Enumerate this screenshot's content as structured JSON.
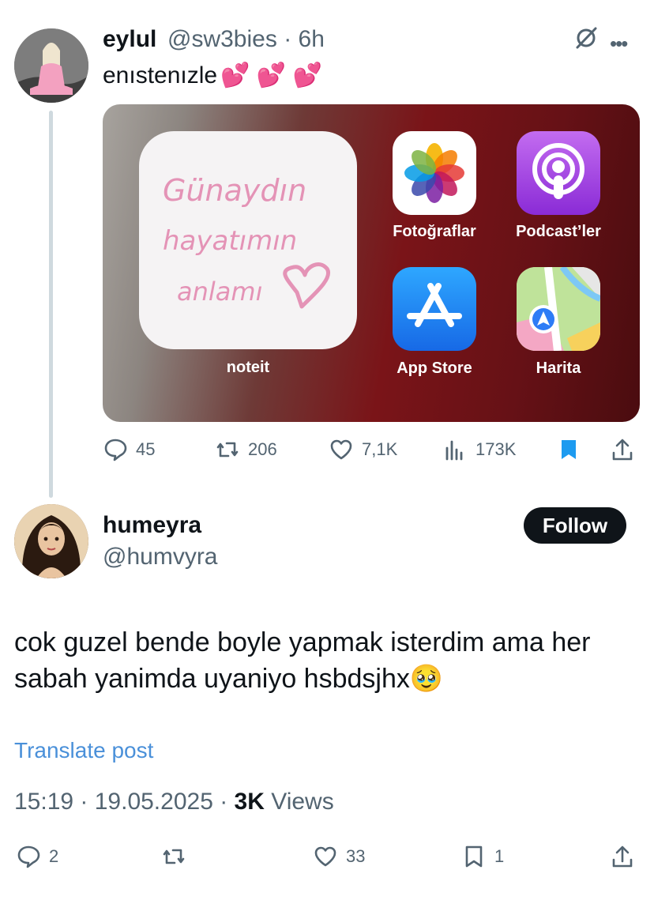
{
  "parent_tweet": {
    "author_name": "eylul",
    "author_handle": "@sw3bies",
    "time_ago": "· 6h",
    "text": "enıstenızle",
    "emoji": "💕 💕 💕",
    "media": {
      "widget_label": "noteit",
      "widget_handwriting": [
        "Günaydın",
        "hayatımın",
        "anlamı"
      ],
      "apps": [
        {
          "label": "Fotoğraflar",
          "icon": "photos-icon"
        },
        {
          "label": "Podcast’ler",
          "icon": "podcasts-icon"
        },
        {
          "label": "App Store",
          "icon": "app-store-icon"
        },
        {
          "label": "Harita",
          "icon": "maps-icon"
        }
      ]
    },
    "actions": {
      "replies": "45",
      "reposts": "206",
      "likes": "7,1K",
      "views": "173K"
    }
  },
  "reply_tweet": {
    "author_name": "humeyra",
    "author_handle": "@humvyra",
    "follow_label": "Follow",
    "text": "cok guzel bende boyle yapmak isterdim ama her sabah yanimda uyaniyo hsbdsjhx🥹",
    "translate_label": "Translate post",
    "time": "15:19 · 19.05.2025 · ",
    "views_count": "3K",
    "views_label": " Views",
    "actions": {
      "replies": "2",
      "reposts": "",
      "likes": "33",
      "bookmarks": "1"
    }
  },
  "colors": {
    "text": "#0f1419",
    "muted": "#536471",
    "link": "#4a90d9",
    "bookmark_active": "#1d9bf0"
  }
}
